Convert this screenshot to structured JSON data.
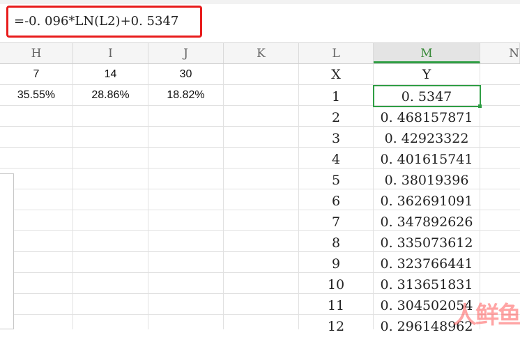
{
  "formula_bar": {
    "formula": "=-0. 096*LN(L2)+0. 5347",
    "highlight_color": "#e81c1c"
  },
  "columns": [
    "H",
    "I",
    "J",
    "K",
    "L",
    "M",
    "N"
  ],
  "active_column": "M",
  "left_table": {
    "row1": [
      "7",
      "14",
      "30"
    ],
    "row2": [
      "35.55%",
      "28.86%",
      "18.82%"
    ]
  },
  "right_table": {
    "header_x": "X",
    "header_y": "Y",
    "rows": [
      {
        "x": "1",
        "y": "0. 5347"
      },
      {
        "x": "2",
        "y": "0. 468157871"
      },
      {
        "x": "3",
        "y": "0. 42923322"
      },
      {
        "x": "4",
        "y": "0. 401615741"
      },
      {
        "x": "5",
        "y": "0. 38019396"
      },
      {
        "x": "6",
        "y": "0. 362691091"
      },
      {
        "x": "7",
        "y": "0. 347892626"
      },
      {
        "x": "8",
        "y": "0. 335073612"
      },
      {
        "x": "9",
        "y": "0. 323766441"
      },
      {
        "x": "10",
        "y": "0. 313651831"
      },
      {
        "x": "11",
        "y": "0. 304502054"
      },
      {
        "x": "12",
        "y": "0. 296148962"
      }
    ]
  },
  "selection_color": "#2f9e44",
  "watermark": "人鲜鱼"
}
